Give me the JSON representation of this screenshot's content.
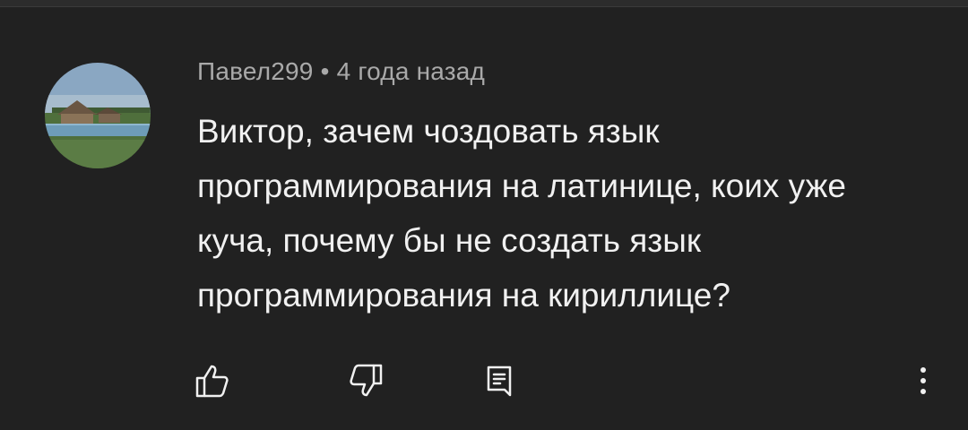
{
  "comment": {
    "author": "Павел299",
    "separator": "•",
    "time": "4 года назад",
    "text": "Виктор, зачем чоздовать язык программирования на латинице, коих уже куча, почему бы не создать язык программирования на кириллице?"
  },
  "actions": {
    "like_icon": "thumb-up-outline",
    "dislike_icon": "thumb-down-outline",
    "reply_icon": "comment-reply",
    "more_icon": "more-vertical"
  },
  "colors": {
    "background": "#212121",
    "primary_text": "#f1f1f1",
    "secondary_text": "#a9a9a9"
  }
}
